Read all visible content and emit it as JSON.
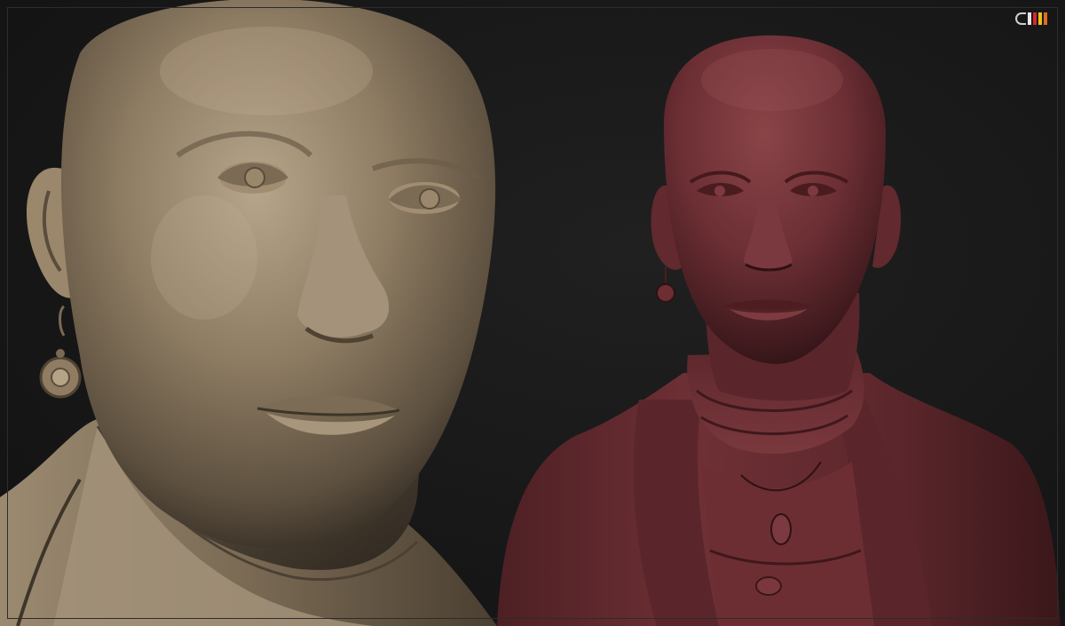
{
  "scene": {
    "left_bust": {
      "material": "clay",
      "color": "#8c7a62"
    },
    "right_bust": {
      "material": "red-wax",
      "color": "#6b2f33"
    },
    "background_color": "#171717"
  },
  "logo": {
    "icon": "zbrush-style-logo-icon",
    "bar_colors": [
      "#e8e8e8",
      "#d6262b",
      "#e5c21d",
      "#e36b1c"
    ]
  }
}
